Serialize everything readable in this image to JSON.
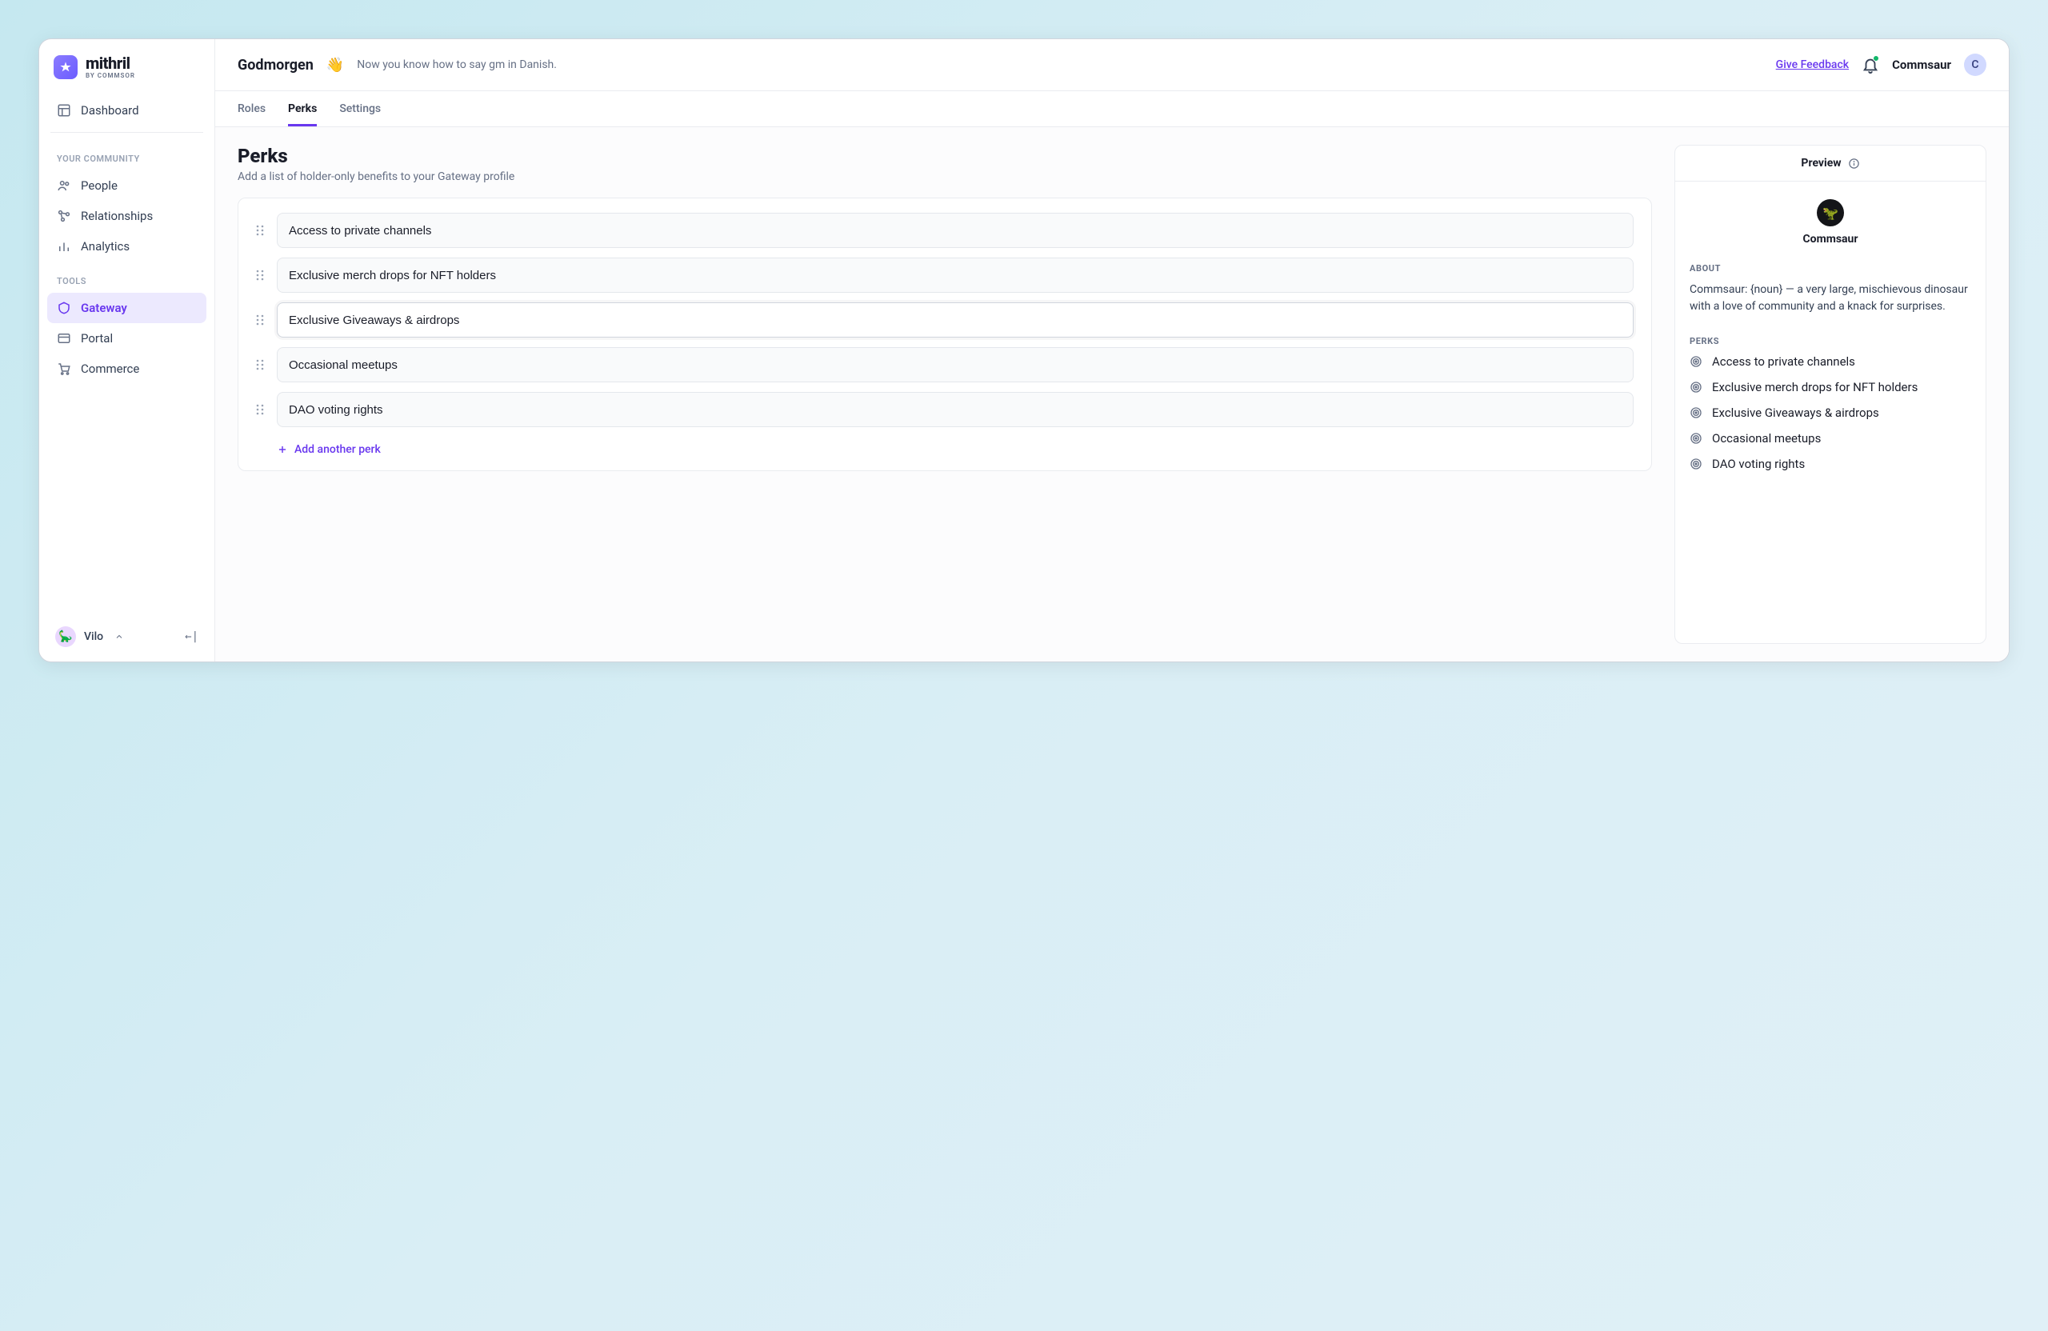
{
  "brand": {
    "name": "mithril",
    "sub": "BY COMMSOR"
  },
  "sidebar": {
    "dashboard": "Dashboard",
    "group_community": "YOUR COMMUNITY",
    "group_tools": "TOOLS",
    "items": {
      "people": "People",
      "relationships": "Relationships",
      "analytics": "Analytics",
      "gateway": "Gateway",
      "portal": "Portal",
      "commerce": "Commerce"
    },
    "footer": {
      "user": "Vilo"
    }
  },
  "topbar": {
    "greeting": "Godmorgen",
    "greeting_sub": "Now you know how to say gm in Danish.",
    "feedback": "Give Feedback",
    "org": "Commsaur",
    "org_initial": "C"
  },
  "tabs": {
    "roles": "Roles",
    "perks": "Perks",
    "settings": "Settings"
  },
  "page": {
    "title": "Perks",
    "subtitle": "Add a list of holder-only benefits to your Gateway profile",
    "add_perk": "Add another perk"
  },
  "perks": [
    "Access to private channels",
    "Exclusive merch drops for NFT holders",
    "Exclusive Giveaways & airdrops",
    "Occasional meetups",
    "DAO voting rights"
  ],
  "preview": {
    "header": "Preview",
    "name": "Commsaur",
    "about_label": "ABOUT",
    "about_text": "Commsaur: {noun} — a very large, mischievous dinosaur with a love of community and a knack for surprises.",
    "perks_label": "PERKS"
  }
}
